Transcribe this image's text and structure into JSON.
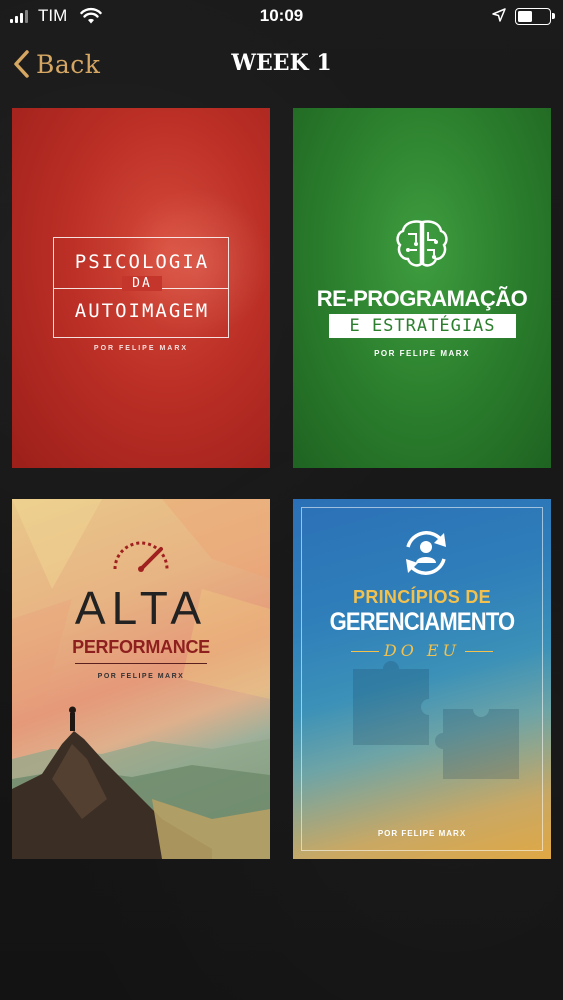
{
  "status_bar": {
    "carrier": "TIM",
    "time": "10:09"
  },
  "nav": {
    "back_label": "Back",
    "title": "WEEK 1"
  },
  "courses": [
    {
      "title_line1": "PSICOLOGIA",
      "title_line2": "DA",
      "title_line3": "AUTOIMAGEM",
      "author": "POR FELIPE MARX",
      "color": "#bb2f26"
    },
    {
      "title_line1": "RE-PROGRAMAÇÃO",
      "title_line2": "E ESTRATÉGIAS",
      "author": "POR FELIPE MARX",
      "color": "#2b7f2d"
    },
    {
      "title_line1": "ALTA",
      "title_line2": "PERFORMANCE",
      "author": "POR FELIPE MARX",
      "color": "#e59979"
    },
    {
      "title_line1": "PRINCÍPIOS DE",
      "title_line2": "GERENCIAMENTO",
      "title_line3": "DO EU",
      "author": "POR FELIPE MARX",
      "color": "#2f7fba"
    }
  ],
  "colors": {
    "accent": "#d6a763",
    "background": "#161616"
  }
}
